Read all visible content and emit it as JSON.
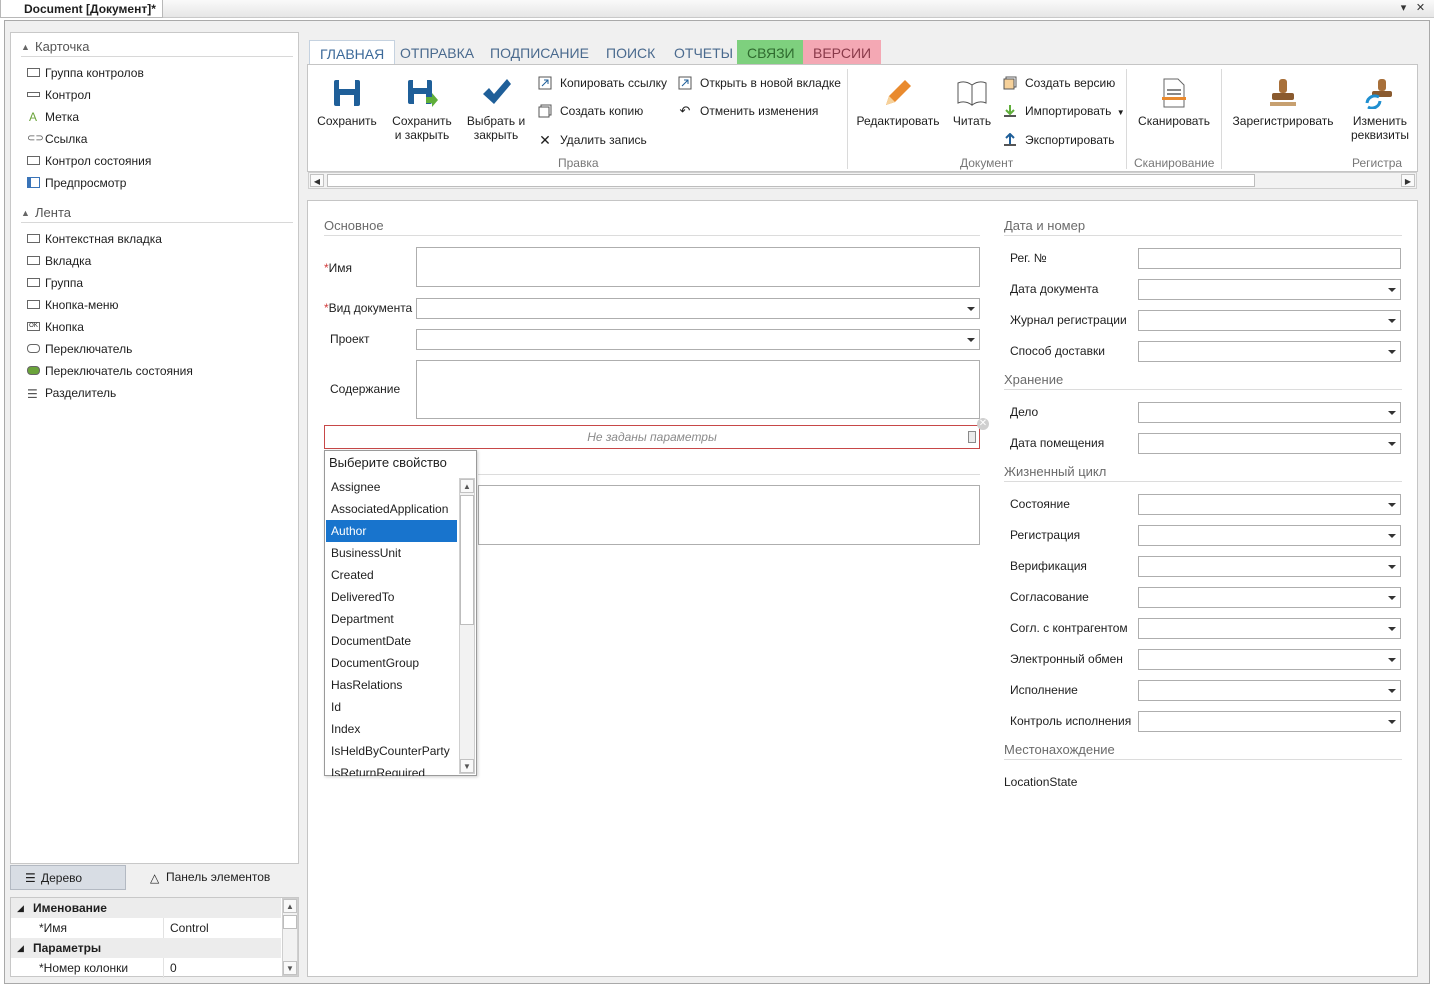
{
  "window": {
    "tab_title": "Document [Документ]*"
  },
  "left_panel": {
    "section1": "Карточка",
    "section1_items": [
      "Группа контролов",
      "Контрол",
      "Метка",
      "Ссылка",
      "Контрол состояния",
      "Предпросмотр"
    ],
    "section2": "Лента",
    "section2_items": [
      "Контекстная вкладка",
      "Вкладка",
      "Группа",
      "Кнопка-меню",
      "Кнопка",
      "Переключатель",
      "Переключатель состояния",
      "Разделитель"
    ],
    "tabs": {
      "tree": "Дерево",
      "elements": "Панель элементов"
    }
  },
  "properties": {
    "group1": "Именование",
    "name_key": "*Имя",
    "name_value": "Control",
    "group2": "Параметры",
    "col_key": "*Номер колонки",
    "col_value": "0"
  },
  "ribbon": {
    "tabs": [
      "ГЛАВНАЯ",
      "ОТПРАВКА",
      "ПОДПИСАНИЕ",
      "ПОИСК",
      "ОТЧЕТЫ",
      "СВЯЗИ",
      "ВЕРСИИ"
    ],
    "tab_colors": {
      "svyazi": "#7ed07e",
      "versii": "#f4a8b4"
    },
    "save": "Сохранить",
    "save_close_1": "Сохранить",
    "save_close_2": "и закрыть",
    "choose_close_1": "Выбрать и",
    "choose_close_2": "закрыть",
    "copy_link": "Копировать ссылку",
    "create_copy": "Создать копию",
    "delete_record": "Удалить запись",
    "open_new_tab": "Открыть в новой вкладке",
    "cancel_changes": "Отменить изменения",
    "group_edit": "Правка",
    "edit": "Редактировать",
    "read": "Читать",
    "create_version": "Создать версию",
    "import": "Импортировать",
    "export": "Экспортировать",
    "group_document": "Документ",
    "scan": "Сканировать",
    "group_scan": "Сканирование",
    "register": "Зарегистрировать",
    "change_req_1": "Изменить",
    "change_req_2": "реквизиты",
    "group_reg": "Регистра"
  },
  "form": {
    "main_section": "Основное",
    "name_label": "Имя",
    "doc_type_label": "Вид документа",
    "project_label": "Проект",
    "content_label": "Содержание",
    "param_placeholder": "Не заданы параметры",
    "date_section": "Дата и номер",
    "reg_no": "Рег. №",
    "doc_date": "Дата документа",
    "reg_journal": "Журнал регистрации",
    "delivery": "Способ доставки",
    "storage_section": "Хранение",
    "case": "Дело",
    "placement_date": "Дата помещения",
    "lifecycle_section": "Жизненный цикл",
    "state": "Состояние",
    "registration": "Регистрация",
    "verification": "Верификация",
    "approval": "Согласование",
    "approval_cp": "Согл. с контрагентом",
    "edi": "Электронный обмен",
    "execution": "Исполнение",
    "exec_control": "Контроль исполнения",
    "location_section": "Местонахождение",
    "location_state": "LocationState"
  },
  "popup": {
    "title": "Выберите свойство",
    "options": [
      "Assignee",
      "AssociatedApplication",
      "Author",
      "BusinessUnit",
      "Created",
      "DeliveredTo",
      "Department",
      "DocumentDate",
      "DocumentGroup",
      "HasRelations",
      "Id",
      "Index",
      "IsHeldByCounterParty",
      "IsReturnRequired"
    ],
    "selected": "Author"
  }
}
